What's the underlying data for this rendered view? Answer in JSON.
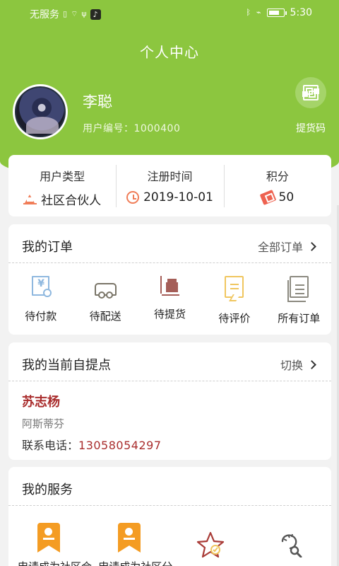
{
  "status_bar": {
    "carrier": "无服务",
    "time": "5:30"
  },
  "header": {
    "title": "个人中心"
  },
  "profile": {
    "name": "李聪",
    "user_id": "用户编号：1000400",
    "qr_label": "提货码"
  },
  "stats": [
    {
      "title": "用户类型",
      "value": "社区合伙人",
      "icon": "crown-icon"
    },
    {
      "title": "注册时间",
      "value": "2019-10-01",
      "icon": "clock-icon"
    },
    {
      "title": "积分",
      "value": "50",
      "icon": "ticket-icon"
    }
  ],
  "orders": {
    "title": "我的订单",
    "link": "全部订单",
    "items": [
      {
        "label": "待付款",
        "icon": "payment-icon",
        "color": "#8fb8df"
      },
      {
        "label": "待配送",
        "icon": "truck-icon",
        "color": "#7a7568"
      },
      {
        "label": "待提货",
        "icon": "cart-icon",
        "color": "#a55e58"
      },
      {
        "label": "待评价",
        "icon": "comment-icon",
        "color": "#f0c65f"
      },
      {
        "label": "所有订单",
        "icon": "documents-icon",
        "color": "#8c8a80"
      }
    ]
  },
  "pickup": {
    "title": "我的当前自提点",
    "link": "切换",
    "name": "苏志杨",
    "address": "阿斯蒂芬",
    "phone_label": "联系电话：",
    "phone": "13058054297"
  },
  "services": {
    "title": "我的服务",
    "items": [
      {
        "label": "申请成为社区合",
        "icon": "badge-icon"
      },
      {
        "label": "申请成为社区分",
        "icon": "badge-icon"
      },
      {
        "label": "",
        "icon": "star-check-icon"
      },
      {
        "label": "",
        "icon": "search-service-icon"
      }
    ]
  },
  "colors": {
    "brand": "#8cc63f",
    "accent": "#f07d58",
    "highlight_text": "#a92d2d"
  }
}
